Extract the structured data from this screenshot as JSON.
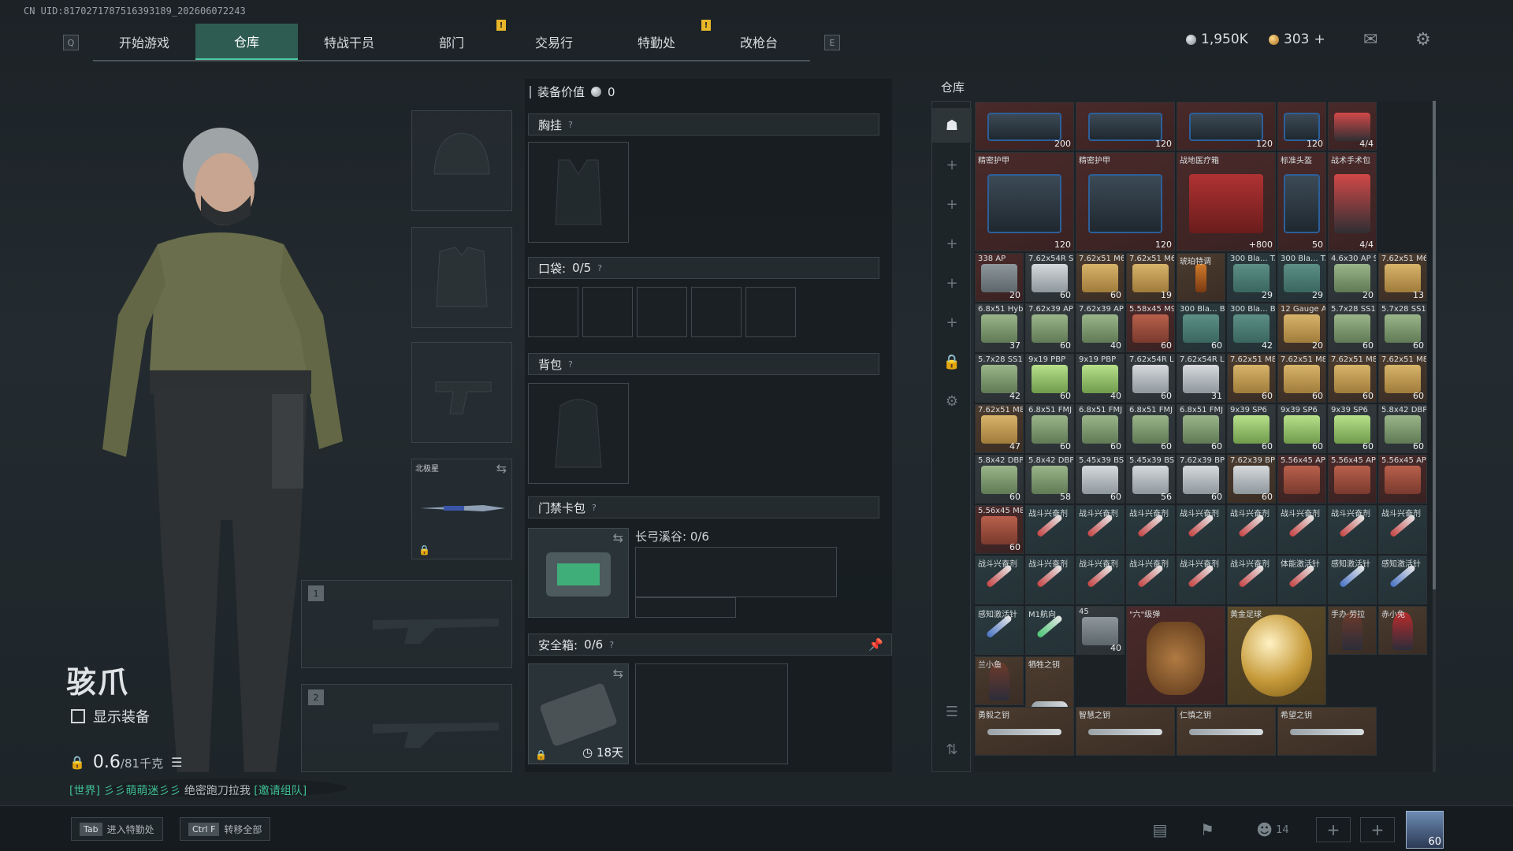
{
  "uid": "CN UID:8170271787516393189_202606072243",
  "nav": {
    "key_left": "Q",
    "key_right": "E",
    "tabs": [
      {
        "label": "开始游戏",
        "active": false,
        "badge": ""
      },
      {
        "label": "仓库",
        "active": true,
        "badge": ""
      },
      {
        "label": "特战干员",
        "active": false,
        "badge": ""
      },
      {
        "label": "部门",
        "active": false,
        "badge": "!"
      },
      {
        "label": "交易行",
        "active": false,
        "badge": ""
      },
      {
        "label": "特勤处",
        "active": false,
        "badge": "!"
      },
      {
        "label": "改枪台",
        "active": false,
        "badge": ""
      }
    ]
  },
  "currency": {
    "silver": "1,950K",
    "gold": "303",
    "gold_add": "+"
  },
  "operator": {
    "name": "骇爪",
    "show_equipment": "显示装备",
    "weight_value": "0.6",
    "weight_max": "/81千克"
  },
  "gear_slots": {
    "backpack_name": "北极星",
    "weapon1": "1",
    "weapon2": "2"
  },
  "chat": {
    "channel": "[世界]",
    "user": "彡彡萌萌迷彡彡",
    "message": "绝密跑刀拉我",
    "invite": "[邀请组队]"
  },
  "bottom_hints": [
    {
      "key": "Tab",
      "label": "进入特勤处"
    },
    {
      "key": "Ctrl F",
      "label": "转移全部"
    }
  ],
  "social": {
    "friends_count": "14",
    "avatar_level": "60"
  },
  "loadout": {
    "value_label": "装备价值",
    "value": "0",
    "chest_rig": "胸挂",
    "pockets_label": "口袋:",
    "pockets_value": "0/5",
    "backpack": "背包",
    "keycard_case": "门禁卡包",
    "keycard_map": "长弓溪谷: 0/6",
    "safe_box_label": "安全箱:",
    "safe_box_value": "0/6",
    "safe_box_timer": "18天"
  },
  "warehouse": {
    "title": "仓库",
    "rows": [
      [
        {
          "n": "",
          "c": "200",
          "bg": "red",
          "art": "armor"
        },
        {
          "n": "",
          "c": "120",
          "bg": "red",
          "art": "armor"
        },
        {
          "n": "",
          "c": "120",
          "bg": "red",
          "art": "armor"
        },
        {
          "n": "",
          "c": "120",
          "bg": "red",
          "art": "armor"
        },
        {
          "n": "",
          "c": "4/4",
          "bg": "red",
          "art": "tool"
        }
      ],
      [
        {
          "n": "精密护甲",
          "c": "120",
          "bg": "red",
          "art": "armor"
        },
        {
          "n": "精密护甲",
          "c": "120",
          "bg": "red",
          "art": "armor"
        },
        {
          "n": "战地医疗箱",
          "c": "+800",
          "bg": "red",
          "art": "med"
        },
        {
          "n": "标准头盔",
          "c": "50",
          "bg": "red",
          "art": "armor"
        },
        {
          "n": "战术手术包",
          "c": "4/4",
          "bg": "red",
          "art": "tool"
        }
      ],
      [
        {
          "n": "338 AP",
          "c": "20",
          "bg": "red",
          "art": "ammo-gray"
        },
        {
          "n": "7.62x54R SNB",
          "c": "60",
          "bg": "gray",
          "art": "ammo-wht"
        },
        {
          "n": "7.62x51 M62",
          "c": "60",
          "bg": "brn",
          "art": "ammo-tan"
        },
        {
          "n": "7.62x51 M61",
          "c": "19",
          "bg": "brn",
          "art": "ammo-tan"
        },
        {
          "n": "琥珀特调",
          "c": "",
          "bg": "brn",
          "art": "drink"
        },
        {
          "n": "300 Bla... TACTX",
          "c": "29",
          "bg": "teal",
          "art": "ammo-teal"
        },
        {
          "n": "300 Bla... TACTX",
          "c": "29",
          "bg": "teal",
          "art": "ammo-teal"
        },
        {
          "n": "4.6x30 AP SX",
          "c": "20",
          "bg": "gray",
          "art": "ammo-grn"
        },
        {
          "n": "7.62x51 M62",
          "c": "13",
          "bg": "brn",
          "art": "ammo-tan"
        }
      ],
      [
        {
          "n": "6.8x51 Hybrid",
          "c": "37",
          "bg": "gray",
          "art": "ammo-grn"
        },
        {
          "n": "7.62x39 AP",
          "c": "60",
          "bg": "gray",
          "art": "ammo-grn"
        },
        {
          "n": "7.62x39 AP",
          "c": "40",
          "bg": "gray",
          "art": "ammo-grn"
        },
        {
          "n": "5.58x45 M995",
          "c": "60",
          "bg": "red",
          "art": "ammo-red"
        },
        {
          "n": "300 Bla... BPSPEMJ",
          "c": "60",
          "bg": "teal",
          "art": "ammo-teal"
        },
        {
          "n": "300 Bla... BPSPEMJ",
          "c": "42",
          "bg": "teal",
          "art": "ammo-teal"
        },
        {
          "n": "12 Gauge AP-20",
          "c": "20",
          "bg": "brn",
          "art": "ammo-tan"
        },
        {
          "n": "5.7x28 SS190",
          "c": "60",
          "bg": "gray",
          "art": "ammo-grn"
        },
        {
          "n": "5.7x28 SS190",
          "c": "60",
          "bg": "gray",
          "art": "ammo-grn"
        }
      ],
      [
        {
          "n": "5.7x28 SS190",
          "c": "42",
          "bg": "gray",
          "art": "ammo-grn"
        },
        {
          "n": "9x19 PBP",
          "c": "60",
          "bg": "gray",
          "art": "ammo-lime"
        },
        {
          "n": "9x19 PBP",
          "c": "40",
          "bg": "gray",
          "art": "ammo-lime"
        },
        {
          "n": "7.62x54R LPS",
          "c": "60",
          "bg": "gray",
          "art": "ammo-wht"
        },
        {
          "n": "7.62x54R LPS",
          "c": "31",
          "bg": "gray",
          "art": "ammo-wht"
        },
        {
          "n": "7.62x51 M80",
          "c": "60",
          "bg": "brn",
          "art": "ammo-tan"
        },
        {
          "n": "7.62x51 M80",
          "c": "60",
          "bg": "brn",
          "art": "ammo-tan"
        },
        {
          "n": "7.62x51 M80",
          "c": "60",
          "bg": "brn",
          "art": "ammo-tan"
        },
        {
          "n": "7.62x51 M80",
          "c": "60",
          "bg": "brn",
          "art": "ammo-tan"
        }
      ],
      [
        {
          "n": "7.62x51 M80",
          "c": "47",
          "bg": "brn",
          "art": "ammo-tan"
        },
        {
          "n": "6.8x51 FMJ",
          "c": "60",
          "bg": "gray",
          "art": "ammo-grn"
        },
        {
          "n": "6.8x51 FMJ",
          "c": "60",
          "bg": "gray",
          "art": "ammo-grn"
        },
        {
          "n": "6.8x51 FMJ",
          "c": "60",
          "bg": "gray",
          "art": "ammo-grn"
        },
        {
          "n": "6.8x51 FMJ",
          "c": "60",
          "bg": "gray",
          "art": "ammo-grn"
        },
        {
          "n": "9x39 SP6",
          "c": "60",
          "bg": "gray",
          "art": "ammo-lime"
        },
        {
          "n": "9x39 SP6",
          "c": "60",
          "bg": "gray",
          "art": "ammo-lime"
        },
        {
          "n": "9x39 SP6",
          "c": "60",
          "bg": "gray",
          "art": "ammo-lime"
        },
        {
          "n": "5.8x42 DBP10",
          "c": "60",
          "bg": "gray",
          "art": "ammo-grn"
        }
      ],
      [
        {
          "n": "5.8x42 DBP10",
          "c": "60",
          "bg": "gray",
          "art": "ammo-grn"
        },
        {
          "n": "5.8x42 DBP10",
          "c": "58",
          "bg": "gray",
          "art": "ammo-grn"
        },
        {
          "n": "5.45x39 BS",
          "c": "60",
          "bg": "gray",
          "art": "ammo-wht"
        },
        {
          "n": "5.45x39 BS",
          "c": "56",
          "bg": "gray",
          "art": "ammo-wht"
        },
        {
          "n": "7.62x39 BP",
          "c": "60",
          "bg": "gray",
          "art": "ammo-wht"
        },
        {
          "n": "7.62x39 BP",
          "c": "60",
          "bg": "brn",
          "art": "ammo-wht"
        },
        {
          "n": "5.56x45 APC",
          "c": "",
          "bg": "red",
          "art": "ammo-red"
        },
        {
          "n": "5.56x45 APC",
          "c": "",
          "bg": "red",
          "art": "ammo-red"
        },
        {
          "n": "5.56x45 APC",
          "c": "",
          "bg": "red",
          "art": "ammo-red"
        }
      ],
      [
        {
          "n": "5.56x45 M855A1",
          "c": "60",
          "bg": "red",
          "art": "ammo-red"
        },
        {
          "n": "战斗兴奋剂",
          "c": "",
          "bg": "teal",
          "art": "inj"
        },
        {
          "n": "战斗兴奋剂",
          "c": "",
          "bg": "teal",
          "art": "inj"
        },
        {
          "n": "战斗兴奋剂",
          "c": "",
          "bg": "teal",
          "art": "inj"
        },
        {
          "n": "战斗兴奋剂",
          "c": "",
          "bg": "teal",
          "art": "inj"
        },
        {
          "n": "战斗兴奋剂",
          "c": "",
          "bg": "teal",
          "art": "inj"
        },
        {
          "n": "战斗兴奋剂",
          "c": "",
          "bg": "teal",
          "art": "inj"
        },
        {
          "n": "战斗兴奋剂",
          "c": "",
          "bg": "teal",
          "art": "inj"
        },
        {
          "n": "战斗兴奋剂",
          "c": "",
          "bg": "teal",
          "art": "inj"
        }
      ],
      [
        {
          "n": "战斗兴奋剂",
          "c": "",
          "bg": "teal",
          "art": "inj"
        },
        {
          "n": "战斗兴奋剂",
          "c": "",
          "bg": "teal",
          "art": "inj"
        },
        {
          "n": "战斗兴奋剂",
          "c": "",
          "bg": "teal",
          "art": "inj"
        },
        {
          "n": "战斗兴奋剂",
          "c": "",
          "bg": "teal",
          "art": "inj"
        },
        {
          "n": "战斗兴奋剂",
          "c": "",
          "bg": "teal",
          "art": "inj"
        },
        {
          "n": "战斗兴奋剂",
          "c": "",
          "bg": "teal",
          "art": "inj"
        },
        {
          "n": "体能激活针",
          "c": "",
          "bg": "teal",
          "art": "inj"
        },
        {
          "n": "感知激活针",
          "c": "",
          "bg": "teal",
          "art": "inj-blue"
        },
        {
          "n": "感知激活针",
          "c": "",
          "bg": "teal",
          "art": "inj-blue"
        }
      ],
      [
        {
          "n": "感知激活针",
          "c": "",
          "bg": "teal",
          "art": "inj-blue"
        },
        {
          "n": "M1航向",
          "c": "",
          "bg": "teal",
          "art": "inj-grn"
        },
        {
          "n": "45",
          "c": "40",
          "bg": "gray",
          "art": "ammo-gray"
        },
        {
          "n": "\"六\"级弹",
          "c": "",
          "bg": "red",
          "art": "hand",
          "wide": 2,
          "tall": 2
        },
        {
          "n": "黄金足球",
          "c": "",
          "bg": "gold",
          "art": "ball",
          "wide": 2,
          "tall": 2
        },
        {
          "n": "手办·劳拉",
          "c": "",
          "bg": "brn",
          "art": "fig"
        },
        {
          "n": "赤小兔",
          "c": "",
          "bg": "brn",
          "art": "fig-red"
        }
      ],
      [
        {
          "n": "兰小鱼",
          "c": "",
          "bg": "brn",
          "art": "fig"
        },
        {
          "n": "牺牲之钥",
          "c": "",
          "bg": "brn",
          "art": "key",
          "tall": 2
        }
      ],
      [
        {
          "n": "勇毅之钥",
          "c": "",
          "bg": "brn",
          "art": "key",
          "wide": 2
        },
        {
          "n": "智慧之钥",
          "c": "",
          "bg": "brn",
          "art": "key",
          "wide": 2
        },
        {
          "n": "仁慎之钥",
          "c": "",
          "bg": "brn",
          "art": "key",
          "wide": 2
        },
        {
          "n": "希望之钥",
          "c": "",
          "bg": "brn",
          "art": "key",
          "wide": 2
        }
      ]
    ]
  },
  "colors": {
    "accent": "#4fc8a0",
    "active_tab": "#2f5c52",
    "badge": "#e8b628"
  }
}
